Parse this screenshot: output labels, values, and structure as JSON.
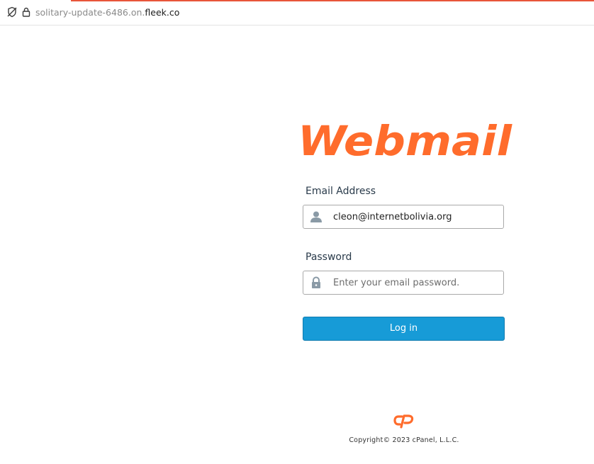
{
  "browser": {
    "url_prefix": "solitary-update-6486.on.",
    "url_domain": "fleek.co",
    "accent_color": "#e8553a"
  },
  "icons": {
    "tracking": "tracking-protection-icon",
    "lock": "lock-icon",
    "user": "user-icon",
    "password": "padlock-icon",
    "brand": "cpanel-logo"
  },
  "logo": {
    "text": "Webmail",
    "color": "#ff6c2c"
  },
  "form": {
    "email_label": "Email Address",
    "email_value": "cleon@internetbolivia.org",
    "password_label": "Password",
    "password_placeholder": "Enter your email password.",
    "password_value": "",
    "login_label": "Log in",
    "button_color": "#179bd7"
  },
  "footer": {
    "copyright": "Copyright© 2023 cPanel, L.L.C."
  }
}
